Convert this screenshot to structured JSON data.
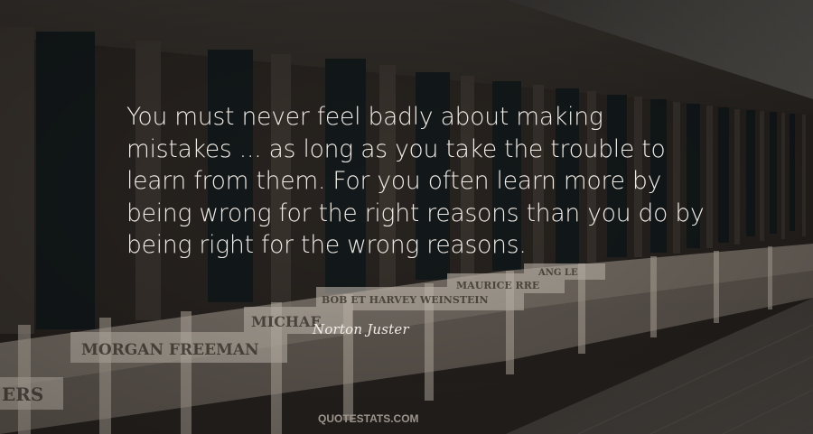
{
  "quote": {
    "text": "You must never feel badly about making mistakes ... as long as you take the trouble to learn from them. For you often learn more by being wrong for the right reasons than you do by being right for the wrong reasons."
  },
  "author": "Norton Juster",
  "watermark": "QUOTESTATS.COM",
  "background": {
    "description_signs": [
      "MORGAN FREEMAN",
      "MICHAE",
      "BOB ET HARVEY WEINSTEIN",
      "MAURICE",
      "ANG LE",
      "RRE",
      "ERS"
    ]
  },
  "colors": {
    "text": "#f1ece6",
    "watermark": "#9b948c",
    "background": "#26221f"
  }
}
